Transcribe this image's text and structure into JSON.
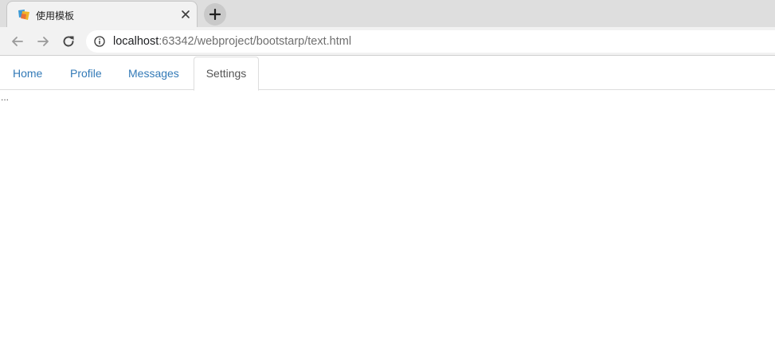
{
  "browser": {
    "tab_title": "使用模板",
    "new_tab_label": "+",
    "url_host": "localhost",
    "url_rest": ":63342/webproject/bootstarp/text.html"
  },
  "page": {
    "tabs": [
      {
        "label": "Home",
        "active": false
      },
      {
        "label": "Profile",
        "active": false
      },
      {
        "label": "Messages",
        "active": false
      },
      {
        "label": "Settings",
        "active": true
      }
    ],
    "pane_text": "..."
  },
  "colors": {
    "link": "#337ab7",
    "active_tab_text": "#555555",
    "tab_border": "#dddddd"
  },
  "icons": [
    "favicon-icon",
    "close-icon",
    "plus-icon",
    "back-arrow-icon",
    "forward-arrow-icon",
    "reload-icon",
    "info-icon"
  ]
}
